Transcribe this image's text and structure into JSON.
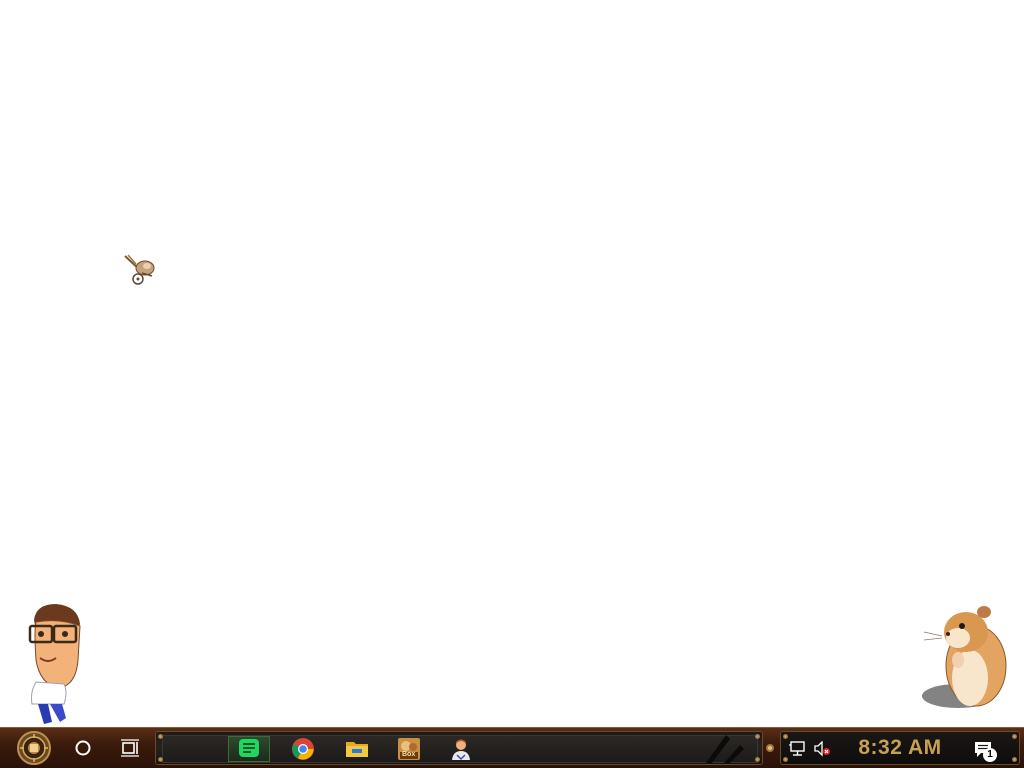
{
  "desktop": {
    "mascots": [
      {
        "name": "airship-mascot"
      },
      {
        "name": "cartoon-man-mascot"
      },
      {
        "name": "hamster-mascot"
      }
    ]
  },
  "taskbar": {
    "start_icon": "steampunk-clock-icon",
    "search_icon": "cortana-circle-icon",
    "task_view_icon": "task-view-icon",
    "pinned_apps": [
      {
        "icon": "notes-app-icon",
        "active": true
      },
      {
        "icon": "chrome-icon",
        "active": false
      },
      {
        "icon": "file-explorer-icon",
        "active": false
      },
      {
        "icon": "game-app-icon",
        "badge_text": "Box",
        "active": false
      },
      {
        "icon": "user-avatar-icon",
        "active": false
      }
    ],
    "tray": {
      "network_icon": "network-icon",
      "volume_icon": "volume-muted-icon",
      "clock": "8:32 AM",
      "notification_icon": "notification-icon",
      "notification_count": "1"
    },
    "colors": {
      "accent": "#c9a050",
      "taskbar": "#3a1b0c",
      "active_app": "#2f4a2e"
    }
  }
}
